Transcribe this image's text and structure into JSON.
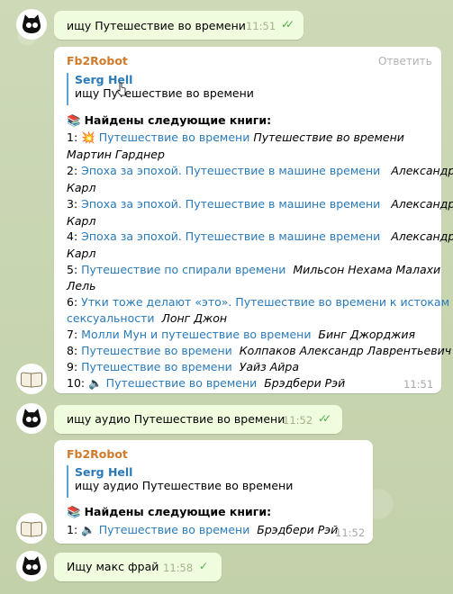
{
  "messages": [
    {
      "text": "ищу Путешествие во времени",
      "time": "11:51"
    },
    {
      "sender": "Fb2Robot",
      "reply_action": "Ответить",
      "quote_name": "Serg Hell",
      "quote_text": "ищу Путешествие во времени",
      "header_icon": "📚",
      "header": "Найдены следующие книги:",
      "results": [
        {
          "num": "1:",
          "icon": "💥",
          "link": "Путешествие во времени",
          "author_line1": "Путешествие во времени",
          "author_line2": "Мартин Гарднер"
        },
        {
          "num": "2:",
          "link": "Эпоха за эпохой. Путешествие в машине времени",
          "author_line1": "Александр",
          "author_line2": "Карл"
        },
        {
          "num": "3:",
          "link": "Эпоха за эпохой. Путешествие в машине времени",
          "author_line1": "Александр",
          "author_line2": "Карл"
        },
        {
          "num": "4:",
          "link": "Эпоха за эпохой. Путешествие в машине времени",
          "author_line1": "Александр",
          "author_line2": "Карл"
        },
        {
          "num": "5:",
          "link": "Путешествие по спирали времени",
          "author_line1": "Мильсон Нехама  Малахи",
          "author_line2": "Лель"
        },
        {
          "num": "6:",
          "link": "Утки тоже делают «это». Путешествие во времени к истокам",
          "link_line2": "сексуальности",
          "author_line1": "Лонг Джон"
        },
        {
          "num": "7:",
          "link": "Молли Мун и путешествие во времени",
          "author_line1": "Бинг Джорджия"
        },
        {
          "num": "8:",
          "link": "Путешествие во времени",
          "author_line1": "Колпаков Александр Лаврентьевич"
        },
        {
          "num": "9:",
          "link": "Путешествие во времени",
          "author_line1": "Уайз Айра"
        },
        {
          "num": "10:",
          "icon": "🔈",
          "link": "Путешествие во времени",
          "author_line1": "Брэдбери Рэй"
        }
      ],
      "time": "11:51"
    },
    {
      "text": "ищу аудио Путешествие во времени",
      "time": "11:52"
    },
    {
      "sender": "Fb2Robot",
      "quote_name": "Serg Hell",
      "quote_text": "ищу аудио Путешествие во времени",
      "header_icon": "📚",
      "header": "Найдены следующие книги:",
      "results": [
        {
          "num": "1:",
          "icon": "🔈",
          "link": "Путешествие во времени",
          "author_line1": "Брэдбери Рэй"
        }
      ],
      "time": "11:52"
    },
    {
      "text": "Ищу макс фрай",
      "time": "11:58"
    }
  ],
  "icons": {
    "user_avatar": "black-cat-avatar",
    "bot_avatar": "open-book-avatar",
    "read_receipt": "double-check-icon",
    "sent_receipt": "single-check-icon"
  },
  "colors": {
    "outgoing_bubble": "#effdde",
    "incoming_bubble": "#ffffff",
    "link": "#2a7ab8",
    "sender": "#d07a2b",
    "check": "#4fae4e"
  }
}
